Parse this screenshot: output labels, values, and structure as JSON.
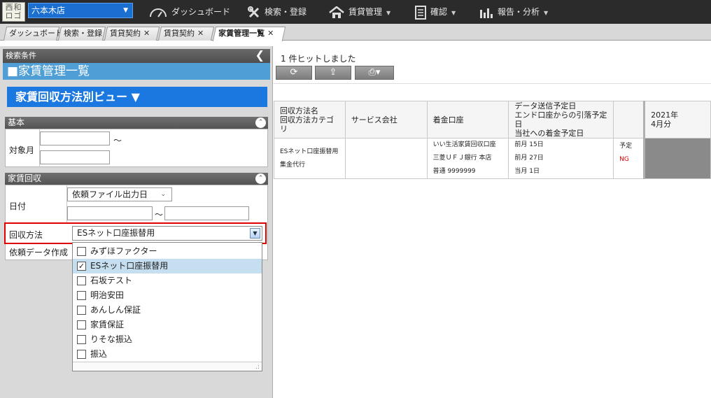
{
  "topbar": {
    "logo": "西和\nロゴ",
    "store": "六本木店",
    "nav": [
      {
        "label": "ダッシュボード",
        "icon": "speedometer-icon"
      },
      {
        "label": "検索・登録",
        "icon": "tools-icon"
      },
      {
        "label": "賃貸管理",
        "icon": "house-icon",
        "dropdown": true
      },
      {
        "label": "確認",
        "icon": "document-icon",
        "dropdown": true
      },
      {
        "label": "報告・分析",
        "icon": "bar-chart-icon",
        "dropdown": true
      }
    ]
  },
  "tabs": [
    {
      "label": "ダッシュボード"
    },
    {
      "label": "検索・登録"
    },
    {
      "label": "賃貸契約",
      "close": "✕"
    },
    {
      "label": "賃貸契約",
      "close": "✕"
    },
    {
      "label": "家賃管理一覧",
      "close": "✕",
      "active": true
    }
  ],
  "left": {
    "header": "検索条件",
    "title": "■家賃管理一覧",
    "view_button": "家賃回収方法別ビュー ▼",
    "basic": {
      "header": "基本",
      "month_label": "対象月",
      "tilde": "～"
    },
    "rent": {
      "header": "家賃回収",
      "date_label": "日付",
      "date_select": "依頼ファイル出力日",
      "tilde": "～",
      "method_label": "回収方法",
      "method_value": "ESネット口座振替用",
      "request_label": "依頼データ作成",
      "options": [
        {
          "label": "みずほファクター",
          "checked": false
        },
        {
          "label": "ESネット口座振替用",
          "checked": true
        },
        {
          "label": "石坂テスト",
          "checked": false
        },
        {
          "label": "明治安田",
          "checked": false
        },
        {
          "label": "あんしん保証",
          "checked": false
        },
        {
          "label": "家賃保証",
          "checked": false
        },
        {
          "label": "りそな振込",
          "checked": false
        },
        {
          "label": "振込",
          "checked": false
        }
      ]
    }
  },
  "right": {
    "hit_text": "1 件ヒットしました",
    "toolbar": {
      "refresh": "⟳",
      "export": "⇪",
      "print": "⎙▾"
    },
    "table": {
      "headers": {
        "method": [
          "回収方法名",
          "回収方法カテゴリ"
        ],
        "service": "サービス会社",
        "account": "着金口座",
        "dates": [
          "データ送信予定日",
          "エンド口座からの引落予定日",
          "当社への着金予定日"
        ],
        "period": [
          "2021年",
          "4月分"
        ]
      },
      "row": {
        "method": [
          "ESネット口座振替用",
          "集金代行"
        ],
        "service": "",
        "account": [
          "いい生活家賃回収口座",
          "三菱ＵＦＪ銀行 本店",
          "普通 9999999"
        ],
        "dates": [
          "前月 15日",
          "前月 27日",
          "当月 1日"
        ],
        "status": [
          "予定",
          "NG"
        ]
      }
    }
  }
}
